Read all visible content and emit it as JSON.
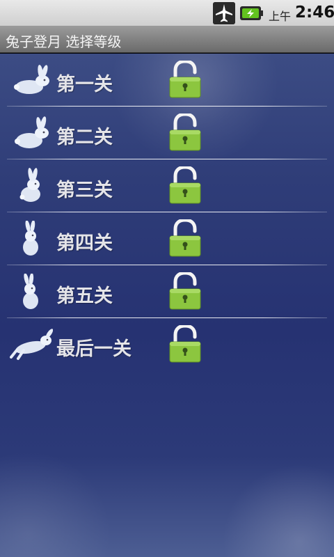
{
  "status_bar": {
    "ampm": "上午",
    "time": "2:46",
    "icons": [
      "airplane-mode-icon",
      "battery-charging-icon"
    ]
  },
  "title_bar": {
    "title": "兔子登月 选择等级"
  },
  "levels": [
    {
      "label": "第一关",
      "rabbit_icon": "rabbit-icon",
      "lock_icon": "unlocked-lock-icon"
    },
    {
      "label": "第二关",
      "rabbit_icon": "rabbit-icon",
      "lock_icon": "unlocked-lock-icon"
    },
    {
      "label": "第三关",
      "rabbit_icon": "rabbit-icon",
      "lock_icon": "unlocked-lock-icon"
    },
    {
      "label": "第四关",
      "rabbit_icon": "rabbit-icon",
      "lock_icon": "unlocked-lock-icon"
    },
    {
      "label": "第五关",
      "rabbit_icon": "rabbit-icon",
      "lock_icon": "unlocked-lock-icon"
    },
    {
      "label": "最后一关",
      "rabbit_icon": "rabbit-icon",
      "lock_icon": "unlocked-lock-icon"
    }
  ],
  "colors": {
    "lock_green": "#8cc63f",
    "lock_shackle": "#f4f4f4",
    "label_text": "#e4e4e8",
    "background": "#2b3876"
  }
}
